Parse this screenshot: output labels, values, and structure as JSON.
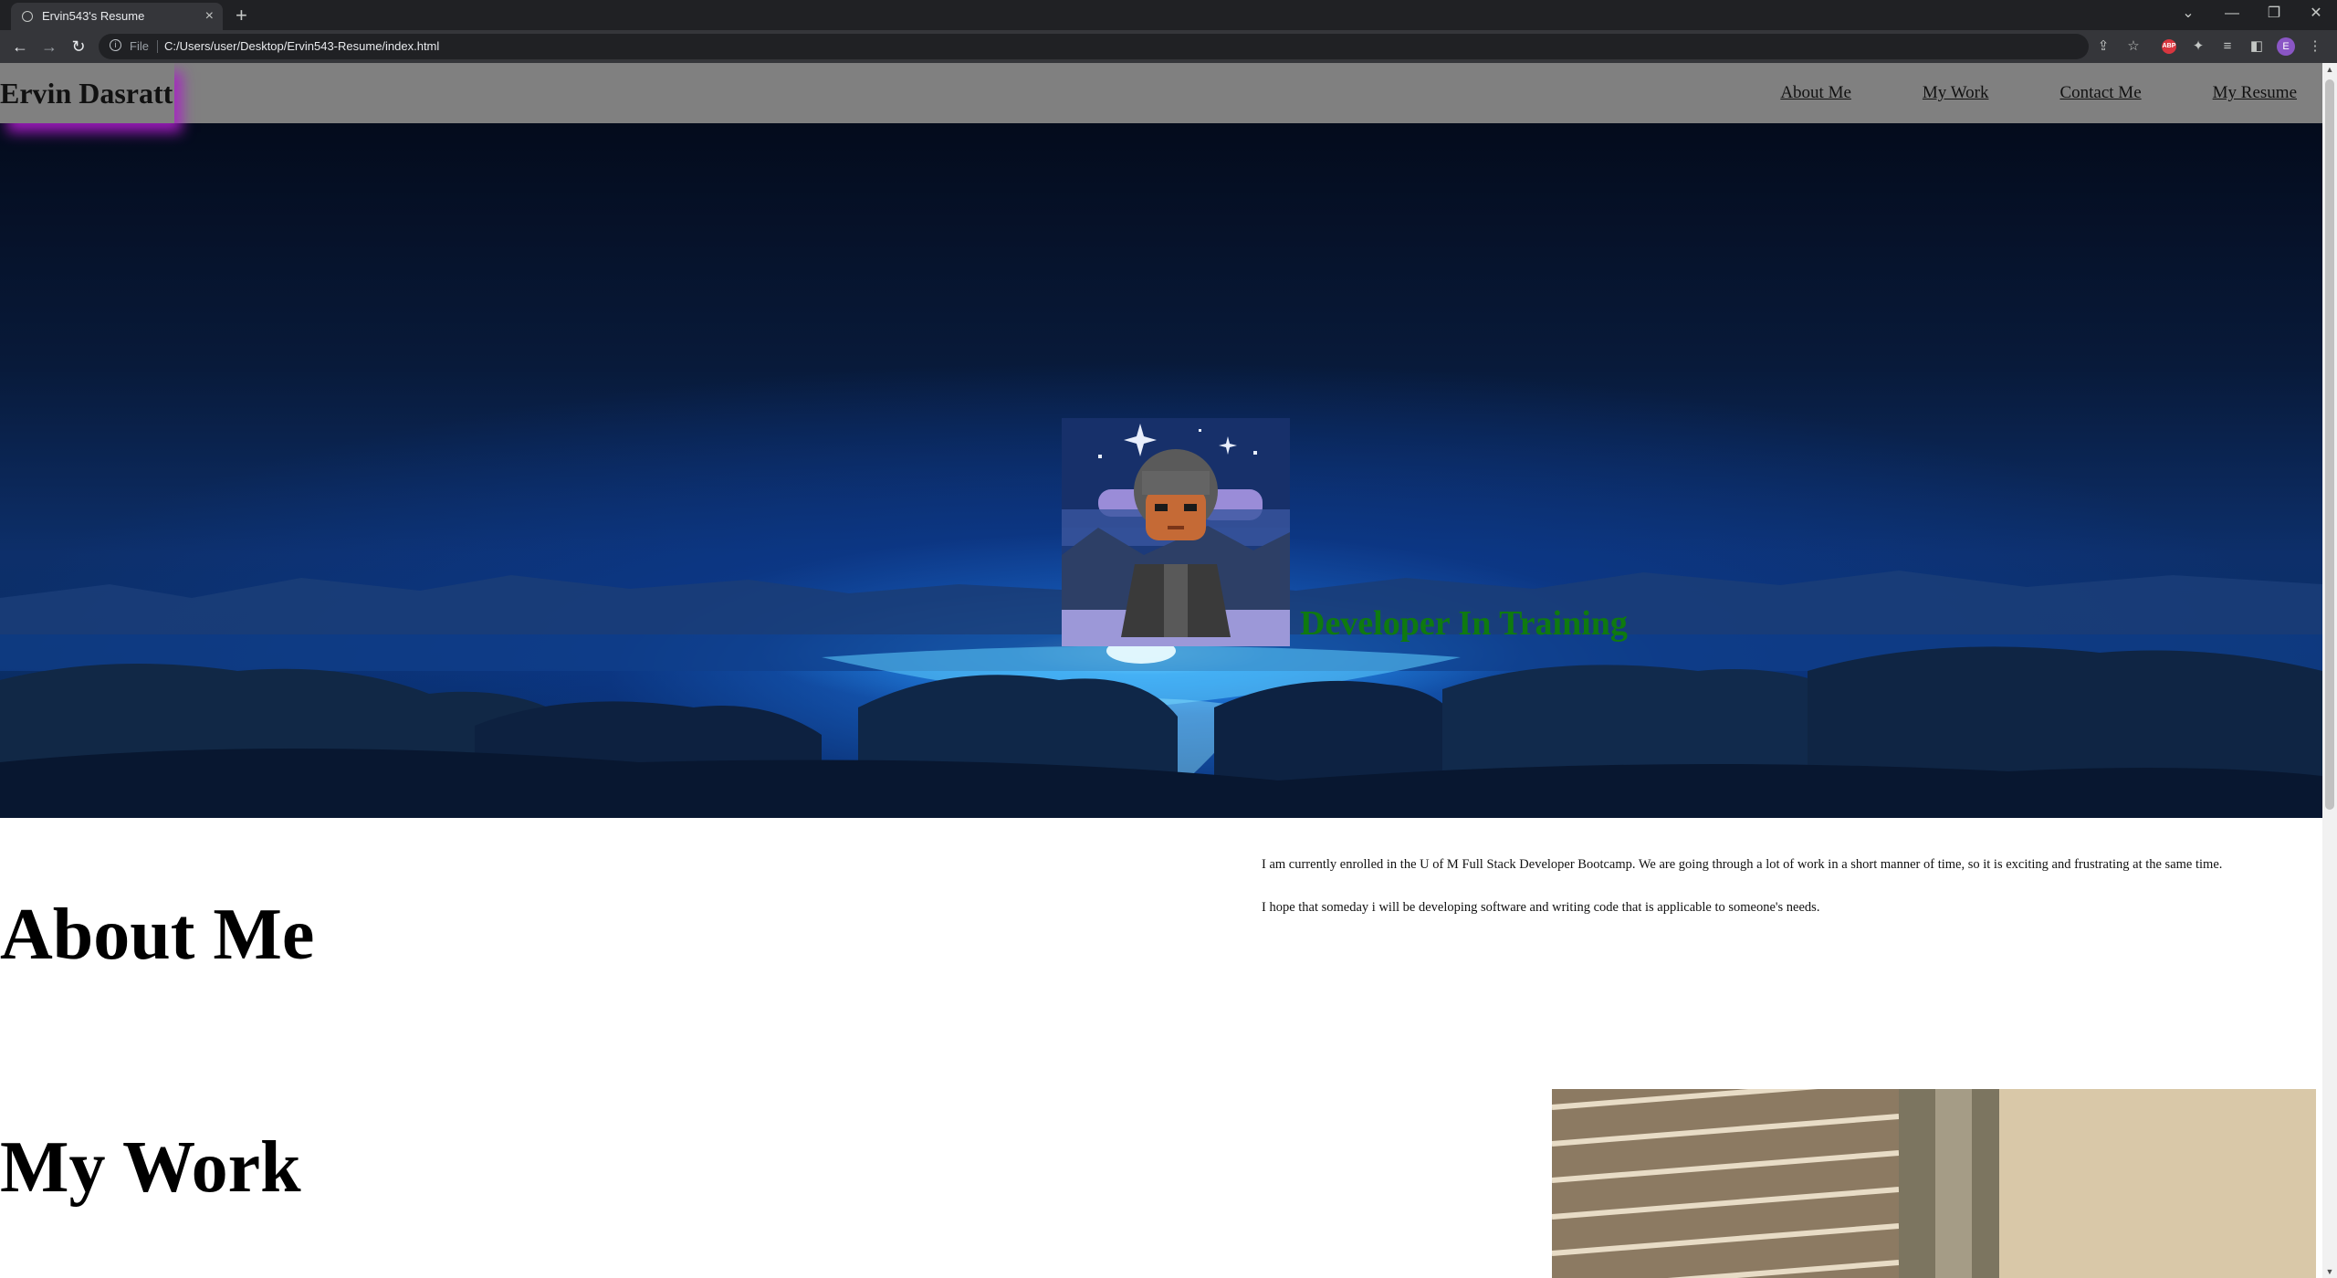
{
  "browser": {
    "tab_title": "Ervin543's Resume",
    "tab_close": "×",
    "new_tab": "+",
    "url_scheme": "File",
    "url": "C:/Users/user/Desktop/Ervin543-Resume/index.html",
    "back": "←",
    "forward": "→",
    "reload": "↻",
    "profile_initial": "E",
    "abp_label": "ABP",
    "window_controls": {
      "chevron": "⌄",
      "minimize": "—",
      "restore": "❐",
      "close": "✕"
    },
    "toolbar_icons": [
      "share-icon",
      "star-icon",
      "adblock-icon",
      "extensions-icon",
      "reading-list-icon",
      "side-panel-icon",
      "profile-icon",
      "menu-icon"
    ]
  },
  "site": {
    "brand": "Ervin Dasratt",
    "nav": [
      "About Me",
      "My Work",
      "Contact Me",
      "My Resume"
    ],
    "tagline": "Developer In Training",
    "tagline_color": "#0f7a10",
    "header_bg": "#808080",
    "brand_glow": "#aa1ec8"
  },
  "about": {
    "title": "About Me",
    "paragraphs": [
      "I am currently enrolled in the U of M Full Stack Developer Bootcamp. We are going through a lot of work in a short manner of time, so it is exciting and frustrating at the same time.",
      "I hope that someday i will be developing software and writing code that is applicable to someone's needs."
    ]
  },
  "work": {
    "title": "My Work"
  }
}
